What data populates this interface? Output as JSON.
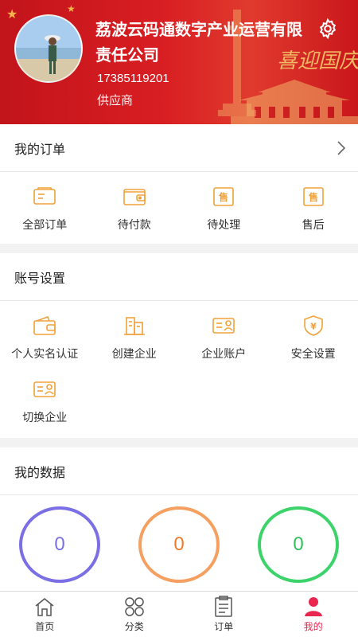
{
  "header": {
    "company_name": "荔波云码通数字产业运营有限责任公司",
    "phone": "17385119201",
    "role": "供应商",
    "decor_text": "喜迎国庆"
  },
  "orders": {
    "title": "我的订单",
    "items": [
      {
        "label": "全部订单",
        "icon": "receipt-icon"
      },
      {
        "label": "待付款",
        "icon": "wallet-icon"
      },
      {
        "label": "待处理",
        "icon": "sale-tag-icon"
      },
      {
        "label": "售后",
        "icon": "after-sale-icon"
      }
    ]
  },
  "account": {
    "title": "账号设置",
    "items": [
      {
        "label": "个人实名认证",
        "icon": "id-wallet-icon"
      },
      {
        "label": "创建企业",
        "icon": "building-icon"
      },
      {
        "label": "企业账户",
        "icon": "id-card-icon"
      },
      {
        "label": "安全设置",
        "icon": "shield-yen-icon"
      },
      {
        "label": "切换企业",
        "icon": "id-card-icon"
      }
    ]
  },
  "data": {
    "title": "我的数据",
    "stats": [
      {
        "value": "0",
        "color": "#7b6fe6"
      },
      {
        "value": "0",
        "color": "#f5a060"
      },
      {
        "value": "0",
        "color": "#3bd36a"
      }
    ]
  },
  "tabbar": {
    "items": [
      {
        "label": "首页",
        "icon": "home-icon"
      },
      {
        "label": "分类",
        "icon": "category-icon"
      },
      {
        "label": "订单",
        "icon": "order-list-icon"
      },
      {
        "label": "我的",
        "icon": "user-icon",
        "active": true
      }
    ]
  },
  "colors": {
    "brand_red": "#d81e22",
    "icon_orange": "#f0a23a",
    "active_tab": "#e9264f"
  }
}
